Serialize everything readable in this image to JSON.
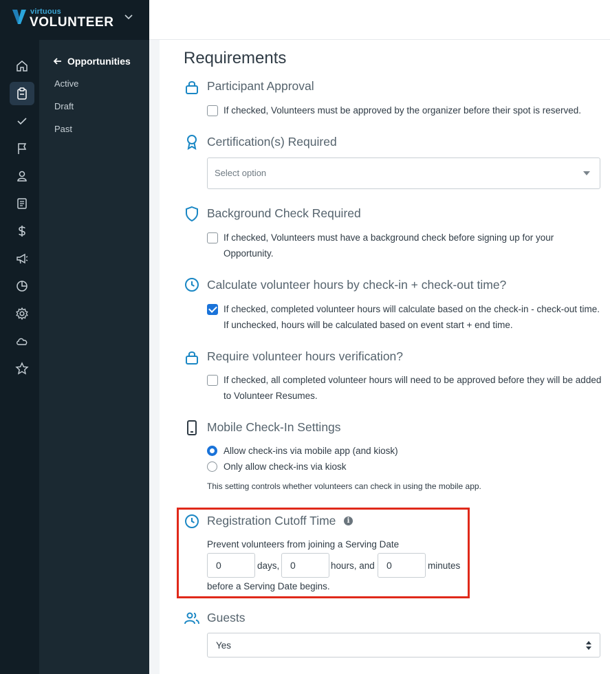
{
  "brand": {
    "small": "virtuous",
    "big": "VOLUNTEER"
  },
  "rail_icons": [
    "home-icon",
    "clipboard-icon",
    "checkmark-icon",
    "flag-icon",
    "person-icon",
    "document-icon",
    "dollar-icon",
    "megaphone-icon",
    "pie-chart-icon",
    "gear-icon",
    "cloud-icon",
    "star-icon"
  ],
  "subnav": {
    "back_label": "Opportunities",
    "items": [
      "Active",
      "Draft",
      "Past"
    ]
  },
  "page": {
    "title": "Requirements"
  },
  "sections": {
    "participant_approval": {
      "title": "Participant Approval",
      "checkbox_label": "If checked, Volunteers must be approved by the organizer before their spot is reserved.",
      "checked": false
    },
    "certification": {
      "title": "Certification(s) Required",
      "placeholder": "Select option"
    },
    "background_check": {
      "title": "Background Check Required",
      "checkbox_label": "If checked, Volunteers must have a background check before signing up for your Opportunity.",
      "checked": false
    },
    "calc_hours": {
      "title": "Calculate volunteer hours by check-in + check-out time?",
      "checkbox_label": "If checked, completed volunteer hours will calculate based on the check-in - check-out time. If unchecked, hours will be calculated based on event start + end time.",
      "checked": true
    },
    "verification": {
      "title": "Require volunteer hours verification?",
      "checkbox_label": "If checked, all completed volunteer hours will need to be approved before they will be added to Volunteer Resumes.",
      "checked": false
    },
    "mobile_checkin": {
      "title": "Mobile Check-In Settings",
      "options": [
        "Allow check-ins via mobile app (and kiosk)",
        "Only allow check-ins via kiosk"
      ],
      "selected_index": 0,
      "helper": "This setting controls whether volunteers can check in using the mobile app."
    },
    "cutoff": {
      "title": "Registration Cutoff Time",
      "intro": "Prevent volunteers from joining a Serving Date",
      "days_value": "0",
      "days_label": "days,",
      "hours_value": "0",
      "hours_label": "hours, and",
      "minutes_value": "0",
      "minutes_label": "minutes",
      "outro": "before a Serving Date begins."
    },
    "guests": {
      "title": "Guests",
      "value": "Yes"
    }
  },
  "colors": {
    "accent": "#1a73d9",
    "icon_blue": "#1a87c4",
    "highlight": "#e0291a",
    "sidebar": "#111d25"
  }
}
